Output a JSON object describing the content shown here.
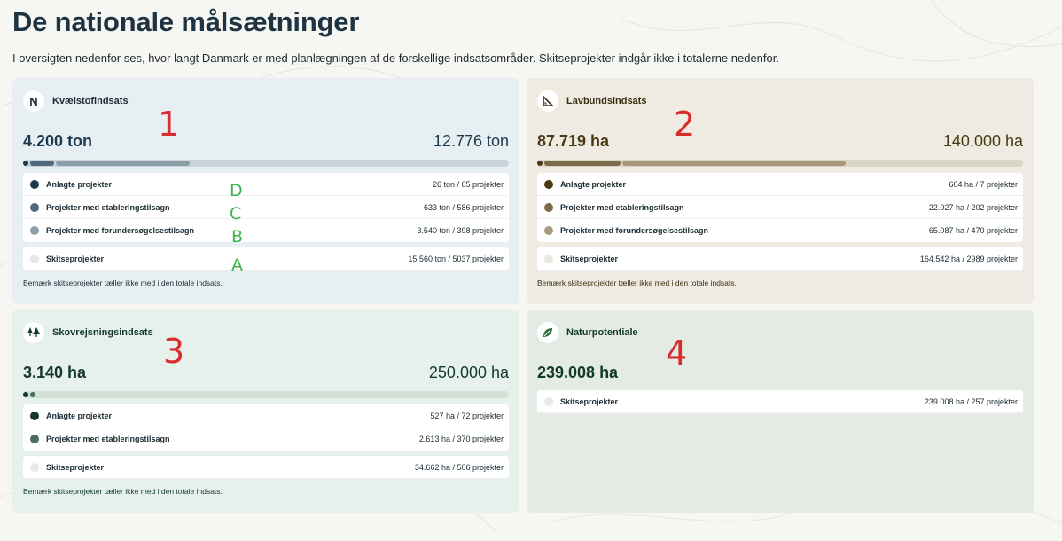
{
  "page": {
    "title": "De nationale målsætninger",
    "intro": "I oversigten nedenfor ses, hvor langt Danmark er med planlægningen af de forskellige indsatsområder. Skitseprojekter indgår ikke i totalerne nedenfor."
  },
  "cards": {
    "kvaelstof": {
      "title": "Kvælstofindsats",
      "icon": "N",
      "total": "4.200 ton",
      "target": "12.776 ton",
      "rows": [
        {
          "label": "Anlagte projekter",
          "value": "26 ton / 65 projekter"
        },
        {
          "label": "Projekter med etableringstilsagn",
          "value": "633 ton / 586 projekter"
        },
        {
          "label": "Projekter med forundersøgelsestilsagn",
          "value": "3.540 ton / 398 projekter"
        }
      ],
      "sketch": {
        "label": "Skitseprojekter",
        "value": "15.560 ton / 5037 projekter"
      },
      "note": "Bemærk skitseprojekter tæller ikke med i den totale indsats.",
      "progress": {
        "anlagt": 26,
        "etablering": 633,
        "forundersogelse": 3540,
        "target": 12776
      }
    },
    "lavbund": {
      "title": "Lavbundsindsats",
      "total": "87.719 ha",
      "target": "140.000 ha",
      "rows": [
        {
          "label": "Anlagte projekter",
          "value": "604 ha / 7 projekter"
        },
        {
          "label": "Projekter med etableringstilsagn",
          "value": "22.027 ha / 202 projekter"
        },
        {
          "label": "Projekter med forundersøgelsestilsagn",
          "value": "65.087 ha / 470 projekter"
        }
      ],
      "sketch": {
        "label": "Skitseprojekter",
        "value": "164.542 ha / 2989 projekter"
      },
      "note": "Bemærk skitseprojekter tæller ikke med i den totale indsats.",
      "progress": {
        "anlagt": 604,
        "etablering": 22027,
        "forundersogelse": 65087,
        "target": 140000
      }
    },
    "skov": {
      "title": "Skovrejsningsindsats",
      "total": "3.140 ha",
      "target": "250.000 ha",
      "rows": [
        {
          "label": "Anlagte projekter",
          "value": "527 ha / 72 projekter"
        },
        {
          "label": "Projekter med etableringstilsagn",
          "value": "2.613 ha / 370 projekter"
        }
      ],
      "sketch": {
        "label": "Skitseprojekter",
        "value": "34.662 ha / 506 projekter"
      },
      "note": "Bemærk skitseprojekter tæller ikke med i den totale indsats.",
      "progress": {
        "anlagt": 527,
        "etablering": 2613,
        "target": 250000
      }
    },
    "natur": {
      "title": "Naturpotentiale",
      "total": "239.008 ha",
      "sketch": {
        "label": "Skitseprojekter",
        "value": "239.008 ha / 257 projekter"
      }
    }
  },
  "annotations": {
    "red": [
      "1",
      "2",
      "3",
      "4"
    ],
    "green": [
      "D",
      "C",
      "B",
      "A"
    ]
  },
  "colors": {
    "blue_dark": "#1c3a4f",
    "blue_mid": "#50697a",
    "blue_light": "#8c9ea8",
    "brown_dark": "#4a3a12",
    "brown_mid": "#7b6a48",
    "brown_light": "#a8997d",
    "green_dark": "#123a2a",
    "green_mid": "#4d6d60",
    "annotation_red": "#d92d2d",
    "annotation_green": "#3cb44a"
  }
}
